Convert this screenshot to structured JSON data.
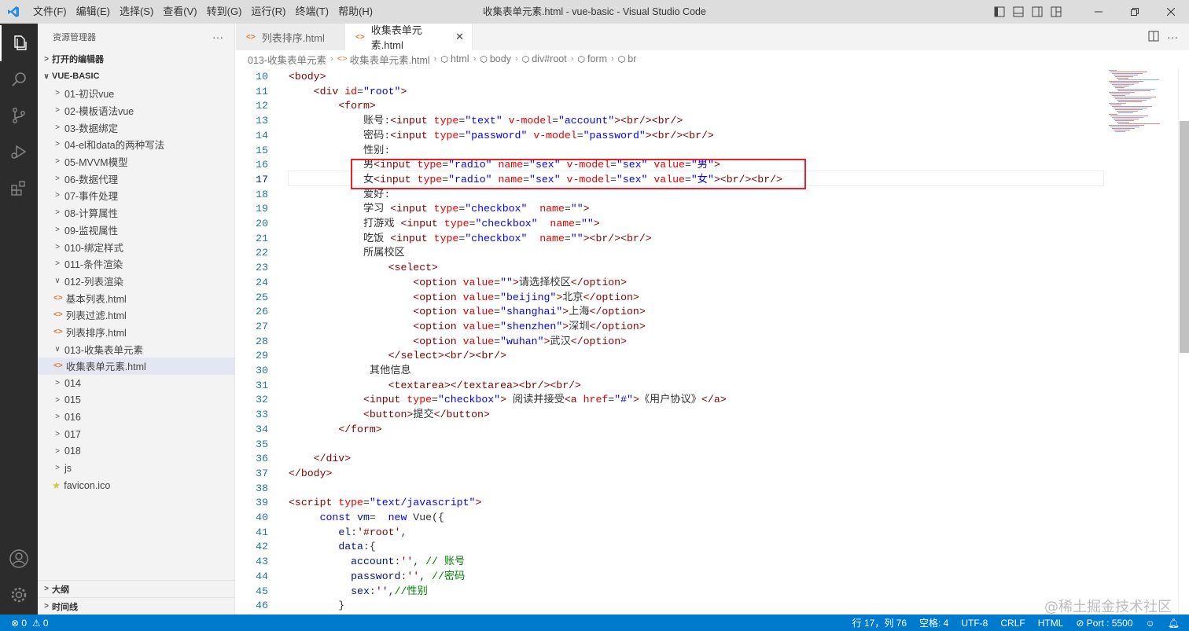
{
  "titlebar": {
    "menu": [
      "文件(F)",
      "编辑(E)",
      "选择(S)",
      "查看(V)",
      "转到(G)",
      "运行(R)",
      "终端(T)",
      "帮助(H)"
    ],
    "window_title": "收集表单元素.html - vue-basic - Visual Studio Code"
  },
  "sidebar": {
    "header": "资源管理器",
    "more": "···",
    "open_editors": "打开的编辑器",
    "root": "VUE-BASIC",
    "items": [
      {
        "label": "01-初识vue",
        "type": "folder"
      },
      {
        "label": "02-模板语法vue",
        "type": "folder"
      },
      {
        "label": "03-数据绑定",
        "type": "folder"
      },
      {
        "label": "04-el和data的两种写法",
        "type": "folder"
      },
      {
        "label": "05-MVVM模型",
        "type": "folder"
      },
      {
        "label": "06-数据代理",
        "type": "folder"
      },
      {
        "label": "07-事件处理",
        "type": "folder"
      },
      {
        "label": "08-计算属性",
        "type": "folder"
      },
      {
        "label": "09-监视属性",
        "type": "folder"
      },
      {
        "label": "010-绑定样式",
        "type": "folder"
      },
      {
        "label": "011-条件渲染",
        "type": "folder"
      },
      {
        "label": "012-列表渲染",
        "type": "folder-open"
      },
      {
        "label": "基本列表.html",
        "type": "file"
      },
      {
        "label": "列表过滤.html",
        "type": "file"
      },
      {
        "label": "列表排序.html",
        "type": "file"
      },
      {
        "label": "013-收集表单元素",
        "type": "folder-open"
      },
      {
        "label": "收集表单元素.html",
        "type": "file-selected"
      },
      {
        "label": "014",
        "type": "folder"
      },
      {
        "label": "015",
        "type": "folder"
      },
      {
        "label": "016",
        "type": "folder"
      },
      {
        "label": "017",
        "type": "folder"
      },
      {
        "label": "018",
        "type": "folder"
      },
      {
        "label": "js",
        "type": "folder"
      },
      {
        "label": "favicon.ico",
        "type": "star"
      }
    ],
    "outline": "大纲",
    "timeline": "时间线"
  },
  "tabs": [
    {
      "label": "列表排序.html",
      "active": false
    },
    {
      "label": "收集表单元素.html",
      "active": true
    }
  ],
  "breadcrumb": [
    "013-收集表单元素",
    "收集表单元素.html",
    "html",
    "body",
    "div#root",
    "form",
    "br"
  ],
  "editor": {
    "current_line": 17,
    "lines": [
      {
        "n": "10",
        "t": [
          [
            "t",
            "<body>"
          ]
        ]
      },
      {
        "n": "11",
        "t": [
          [
            "x",
            "    "
          ],
          [
            "t",
            "<div "
          ],
          [
            "a",
            "id"
          ],
          [
            "x",
            "="
          ],
          [
            "s",
            "\"root\""
          ],
          [
            "t",
            ">"
          ]
        ]
      },
      {
        "n": "12",
        "t": [
          [
            "x",
            "        "
          ],
          [
            "t",
            "<form>"
          ]
        ]
      },
      {
        "n": "13",
        "t": [
          [
            "x",
            "            账号:"
          ],
          [
            "t",
            "<input "
          ],
          [
            "a",
            "type"
          ],
          [
            "x",
            "="
          ],
          [
            "s",
            "\"text\""
          ],
          [
            "x",
            " "
          ],
          [
            "a",
            "v-model"
          ],
          [
            "x",
            "="
          ],
          [
            "s",
            "\"account\""
          ],
          [
            "t",
            "><br/><br/>"
          ]
        ]
      },
      {
        "n": "14",
        "t": [
          [
            "x",
            "            密码:"
          ],
          [
            "t",
            "<input "
          ],
          [
            "a",
            "type"
          ],
          [
            "x",
            "="
          ],
          [
            "s",
            "\"password\""
          ],
          [
            "x",
            " "
          ],
          [
            "a",
            "v-model"
          ],
          [
            "x",
            "="
          ],
          [
            "s",
            "\"password\""
          ],
          [
            "t",
            "><br/><br/>"
          ]
        ]
      },
      {
        "n": "15",
        "t": [
          [
            "x",
            "            性别:"
          ]
        ]
      },
      {
        "n": "16",
        "t": [
          [
            "x",
            "            男"
          ],
          [
            "t",
            "<input "
          ],
          [
            "a",
            "type"
          ],
          [
            "x",
            "="
          ],
          [
            "s",
            "\"radio\""
          ],
          [
            "x",
            " "
          ],
          [
            "a",
            "name"
          ],
          [
            "x",
            "="
          ],
          [
            "s",
            "\"sex\""
          ],
          [
            "x",
            " "
          ],
          [
            "a",
            "v-model"
          ],
          [
            "x",
            "="
          ],
          [
            "s",
            "\"sex\""
          ],
          [
            "x",
            " "
          ],
          [
            "a",
            "value"
          ],
          [
            "x",
            "="
          ],
          [
            "s",
            "\"男\""
          ],
          [
            "t",
            ">"
          ]
        ]
      },
      {
        "n": "17",
        "t": [
          [
            "x",
            "            女"
          ],
          [
            "t",
            "<input "
          ],
          [
            "a",
            "type"
          ],
          [
            "x",
            "="
          ],
          [
            "s",
            "\"radio\""
          ],
          [
            "x",
            " "
          ],
          [
            "a",
            "name"
          ],
          [
            "x",
            "="
          ],
          [
            "s",
            "\"sex\""
          ],
          [
            "x",
            " "
          ],
          [
            "a",
            "v-model"
          ],
          [
            "x",
            "="
          ],
          [
            "s",
            "\"sex\""
          ],
          [
            "x",
            " "
          ],
          [
            "a",
            "value"
          ],
          [
            "x",
            "="
          ],
          [
            "s",
            "\"女\""
          ],
          [
            "t",
            "><br/><br/>"
          ]
        ]
      },
      {
        "n": "18",
        "t": [
          [
            "x",
            "            爱好:"
          ]
        ]
      },
      {
        "n": "19",
        "t": [
          [
            "x",
            "            学习 "
          ],
          [
            "t",
            "<input "
          ],
          [
            "a",
            "type"
          ],
          [
            "x",
            "="
          ],
          [
            "s",
            "\"checkbox\""
          ],
          [
            "x",
            "  "
          ],
          [
            "a",
            "name"
          ],
          [
            "x",
            "="
          ],
          [
            "s",
            "\"\""
          ],
          [
            "t",
            ">"
          ]
        ]
      },
      {
        "n": "20",
        "t": [
          [
            "x",
            "            打游戏 "
          ],
          [
            "t",
            "<input "
          ],
          [
            "a",
            "type"
          ],
          [
            "x",
            "="
          ],
          [
            "s",
            "\"checkbox\""
          ],
          [
            "x",
            "  "
          ],
          [
            "a",
            "name"
          ],
          [
            "x",
            "="
          ],
          [
            "s",
            "\"\""
          ],
          [
            "t",
            ">"
          ]
        ]
      },
      {
        "n": "21",
        "t": [
          [
            "x",
            "            吃饭 "
          ],
          [
            "t",
            "<input "
          ],
          [
            "a",
            "type"
          ],
          [
            "x",
            "="
          ],
          [
            "s",
            "\"checkbox\""
          ],
          [
            "x",
            "  "
          ],
          [
            "a",
            "name"
          ],
          [
            "x",
            "="
          ],
          [
            "s",
            "\"\""
          ],
          [
            "t",
            "><br/><br/>"
          ]
        ]
      },
      {
        "n": "22",
        "t": [
          [
            "x",
            "            所属校区"
          ]
        ]
      },
      {
        "n": "23",
        "t": [
          [
            "x",
            "                "
          ],
          [
            "t",
            "<select>"
          ]
        ]
      },
      {
        "n": "24",
        "t": [
          [
            "x",
            "                    "
          ],
          [
            "t",
            "<option "
          ],
          [
            "a",
            "value"
          ],
          [
            "x",
            "="
          ],
          [
            "s",
            "\"\""
          ],
          [
            "t",
            ">"
          ],
          [
            "x",
            "请选择校区"
          ],
          [
            "t",
            "</option>"
          ]
        ]
      },
      {
        "n": "25",
        "t": [
          [
            "x",
            "                    "
          ],
          [
            "t",
            "<option "
          ],
          [
            "a",
            "value"
          ],
          [
            "x",
            "="
          ],
          [
            "s",
            "\"beijing\""
          ],
          [
            "t",
            ">"
          ],
          [
            "x",
            "北京"
          ],
          [
            "t",
            "</option>"
          ]
        ]
      },
      {
        "n": "26",
        "t": [
          [
            "x",
            "                    "
          ],
          [
            "t",
            "<option "
          ],
          [
            "a",
            "value"
          ],
          [
            "x",
            "="
          ],
          [
            "s",
            "\"shanghai\""
          ],
          [
            "t",
            ">"
          ],
          [
            "x",
            "上海"
          ],
          [
            "t",
            "</option>"
          ]
        ]
      },
      {
        "n": "27",
        "t": [
          [
            "x",
            "                    "
          ],
          [
            "t",
            "<option "
          ],
          [
            "a",
            "value"
          ],
          [
            "x",
            "="
          ],
          [
            "s",
            "\"shenzhen\""
          ],
          [
            "t",
            ">"
          ],
          [
            "x",
            "深圳"
          ],
          [
            "t",
            "</option>"
          ]
        ]
      },
      {
        "n": "28",
        "t": [
          [
            "x",
            "                    "
          ],
          [
            "t",
            "<option "
          ],
          [
            "a",
            "value"
          ],
          [
            "x",
            "="
          ],
          [
            "s",
            "\"wuhan\""
          ],
          [
            "t",
            ">"
          ],
          [
            "x",
            "武汉"
          ],
          [
            "t",
            "</option>"
          ]
        ]
      },
      {
        "n": "29",
        "t": [
          [
            "x",
            "                "
          ],
          [
            "t",
            "</select><br/><br/>"
          ]
        ]
      },
      {
        "n": "30",
        "t": [
          [
            "x",
            "             其他信息"
          ]
        ]
      },
      {
        "n": "31",
        "t": [
          [
            "x",
            "                "
          ],
          [
            "t",
            "<textarea></textarea><br/><br/>"
          ]
        ]
      },
      {
        "n": "32",
        "t": [
          [
            "x",
            "            "
          ],
          [
            "t",
            "<input "
          ],
          [
            "a",
            "type"
          ],
          [
            "x",
            "="
          ],
          [
            "s",
            "\"checkbox\""
          ],
          [
            "t",
            ">"
          ],
          [
            "x",
            " 阅读并接受"
          ],
          [
            "t",
            "<a "
          ],
          [
            "a",
            "href"
          ],
          [
            "x",
            "="
          ],
          [
            "s",
            "\"#\""
          ],
          [
            "t",
            ">"
          ],
          [
            "x",
            "《用户协议》"
          ],
          [
            "t",
            "</a>"
          ]
        ]
      },
      {
        "n": "33",
        "t": [
          [
            "x",
            "            "
          ],
          [
            "t",
            "<button>"
          ],
          [
            "x",
            "提交"
          ],
          [
            "t",
            "</button>"
          ]
        ]
      },
      {
        "n": "34",
        "t": [
          [
            "x",
            "        "
          ],
          [
            "t",
            "</form>"
          ]
        ]
      },
      {
        "n": "35",
        "t": []
      },
      {
        "n": "36",
        "t": [
          [
            "x",
            "    "
          ],
          [
            "t",
            "</div>"
          ]
        ]
      },
      {
        "n": "37",
        "t": [
          [
            "t",
            "</body>"
          ]
        ]
      },
      {
        "n": "38",
        "t": []
      },
      {
        "n": "39",
        "t": [
          [
            "t",
            "<script "
          ],
          [
            "a",
            "type"
          ],
          [
            "x",
            "="
          ],
          [
            "s",
            "\"text/javascript\""
          ],
          [
            "t",
            ">"
          ]
        ]
      },
      {
        "n": "40",
        "t": [
          [
            "x",
            "     "
          ],
          [
            "k",
            "const "
          ],
          [
            "js",
            "vm"
          ],
          [
            "x",
            "=  "
          ],
          [
            "k",
            "new "
          ],
          [
            "x",
            "Vue({"
          ]
        ]
      },
      {
        "n": "41",
        "t": [
          [
            "x",
            "        "
          ],
          [
            "js",
            "el"
          ],
          [
            "x",
            ":"
          ],
          [
            "p",
            "'#root'"
          ],
          [
            "x",
            ","
          ]
        ]
      },
      {
        "n": "42",
        "t": [
          [
            "x",
            "        "
          ],
          [
            "js",
            "data"
          ],
          [
            "x",
            ":{"
          ]
        ]
      },
      {
        "n": "43",
        "t": [
          [
            "x",
            "          "
          ],
          [
            "js",
            "account"
          ],
          [
            "x",
            ":"
          ],
          [
            "p",
            "''"
          ],
          [
            "x",
            ", "
          ],
          [
            "c",
            "// 账号"
          ]
        ]
      },
      {
        "n": "44",
        "t": [
          [
            "x",
            "          "
          ],
          [
            "js",
            "password"
          ],
          [
            "x",
            ":"
          ],
          [
            "p",
            "''"
          ],
          [
            "x",
            ", "
          ],
          [
            "c",
            "//密码"
          ]
        ]
      },
      {
        "n": "45",
        "t": [
          [
            "x",
            "          "
          ],
          [
            "js",
            "sex"
          ],
          [
            "x",
            ":"
          ],
          [
            "p",
            "''"
          ],
          [
            "x",
            ","
          ],
          [
            "c",
            "//性别"
          ]
        ]
      },
      {
        "n": "46",
        "t": [
          [
            "x",
            "        }"
          ]
        ]
      }
    ]
  },
  "statusbar": {
    "errors": "0",
    "warnings": "0",
    "position": "行 17，列 76",
    "spaces": "空格: 4",
    "encoding": "UTF-8",
    "eol": "CRLF",
    "language": "HTML",
    "port": "Port : 5500"
  },
  "watermark": "@稀土掘金技术社区",
  "colors": {
    "statusbar": "#007acc",
    "activitybar": "#2c2c2c",
    "highlight_box": "#e8202a"
  }
}
